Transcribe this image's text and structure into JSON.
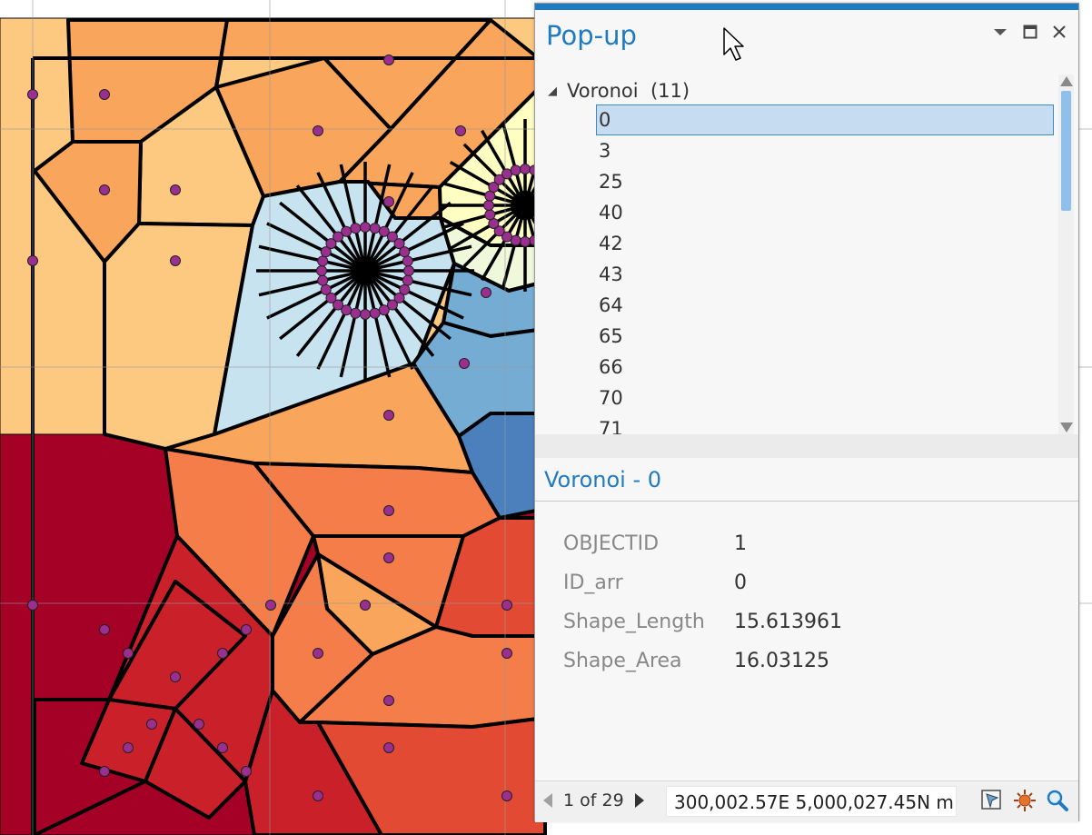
{
  "map": {
    "colors": {
      "light_orange": "#fdc980",
      "orange": "#f9a55c",
      "dark_orange": "#f47d4a",
      "red_orange": "#e34a33",
      "red": "#c9202a",
      "dark_red": "#a50026",
      "pale_yellow": "#fefec2",
      "light_blue": "#c7e3f0",
      "mid_blue": "#75acd3",
      "blue": "#4b80bd",
      "cream": "#f0f8dc",
      "point": "#9b2f8f",
      "edge": "#000000"
    }
  },
  "popup": {
    "title": "Pop-up",
    "icons": {
      "menu": "dropdown-icon",
      "maximize": "maximize-icon",
      "close": "close-icon"
    },
    "tree": {
      "layer": "Voronoi",
      "count": "(11)",
      "items": [
        "0",
        "3",
        "25",
        "40",
        "42",
        "43",
        "64",
        "65",
        "66",
        "70",
        "71"
      ],
      "selected": "0"
    },
    "detail": {
      "title": "Voronoi - 0",
      "fields": [
        {
          "name": "OBJECTID",
          "value": "1"
        },
        {
          "name": "ID_arr",
          "value": "0"
        },
        {
          "name": "Shape_Length",
          "value": "15.613961"
        },
        {
          "name": "Shape_Area",
          "value": "16.03125"
        }
      ]
    },
    "status": {
      "page": "1 of 29",
      "coordinates": "300,002.57E 5,000,027.45N m"
    }
  }
}
